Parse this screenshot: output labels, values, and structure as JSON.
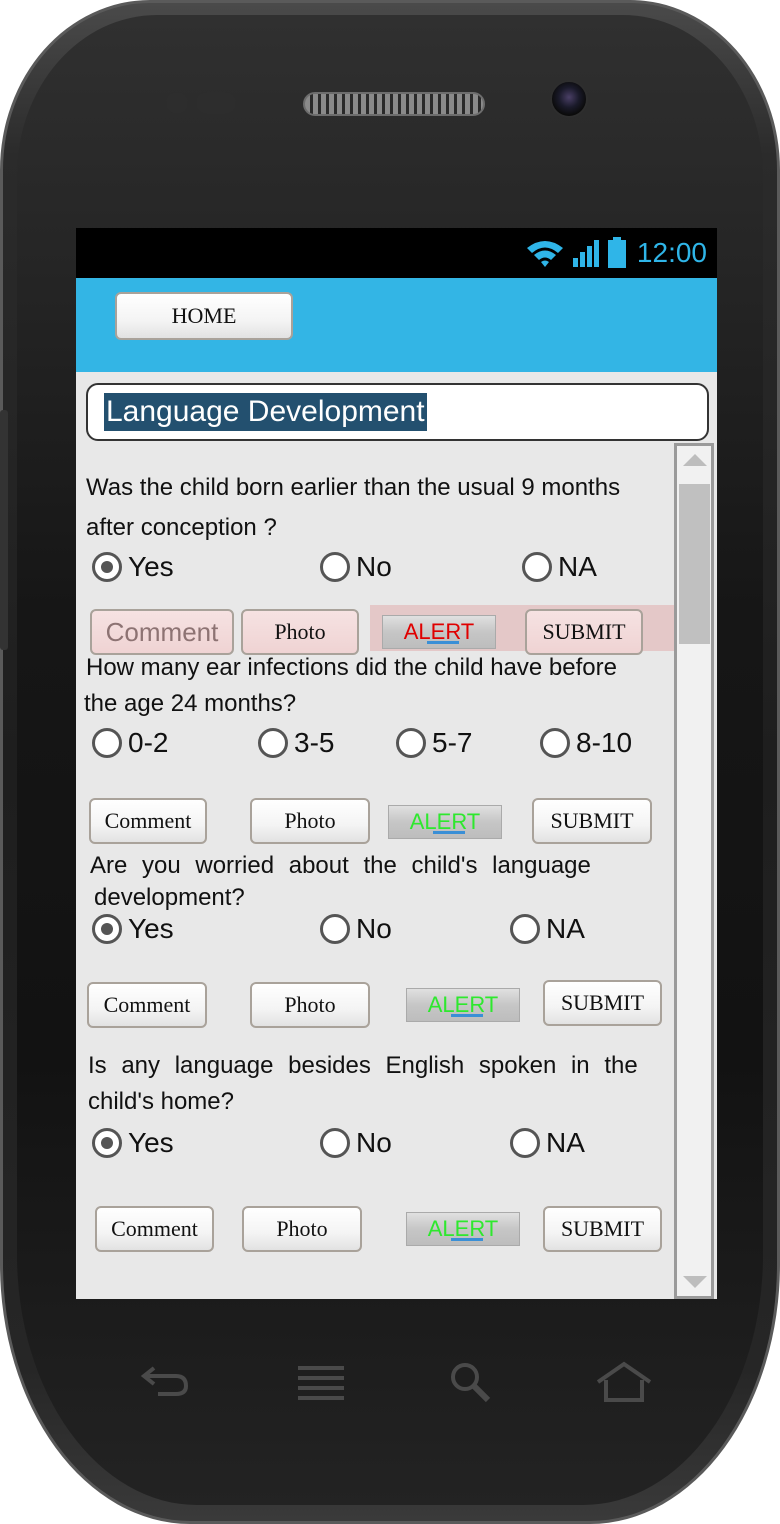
{
  "status_bar": {
    "time": "12:00",
    "icons": [
      "wifi-icon",
      "signal-icon",
      "battery-icon"
    ]
  },
  "toolbar": {
    "home_label": "HOME"
  },
  "page": {
    "title": "Language Development"
  },
  "buttons": {
    "comment": "Comment",
    "photo": "Photo",
    "alert": "ALERT",
    "submit": "SUBMIT"
  },
  "questions": [
    {
      "text_line1": "Was the child born earlier than the usual 9 months",
      "text_line2": "after conception ?",
      "options": [
        "Yes",
        "No",
        "NA"
      ],
      "selected": "Yes",
      "alert_color": "#e00000"
    },
    {
      "text_line1": "How many ear infections did the child have before",
      "text_line2": "the age 24 months?",
      "options": [
        "0-2",
        "3-5",
        "5-7",
        "8-10"
      ],
      "selected": null,
      "alert_color": "#2ee82e"
    },
    {
      "text_line1": "Are you worried about the child's language",
      "text_line2": "development?",
      "options": [
        "Yes",
        "No",
        "NA"
      ],
      "selected": "Yes",
      "alert_color": "#2ee82e"
    },
    {
      "text_line1": "Is any language besides English spoken in the",
      "text_line2": "child's home?",
      "options": [
        "Yes",
        "No",
        "NA"
      ],
      "selected": "Yes",
      "alert_color": "#2ee82e"
    }
  ],
  "colors": {
    "appbar": "#33b5e5",
    "status_icons": "#2fb5e8",
    "title_highlight": "#23506f"
  },
  "nav_keys": [
    "back-icon",
    "menu-icon",
    "search-icon",
    "home-icon"
  ]
}
